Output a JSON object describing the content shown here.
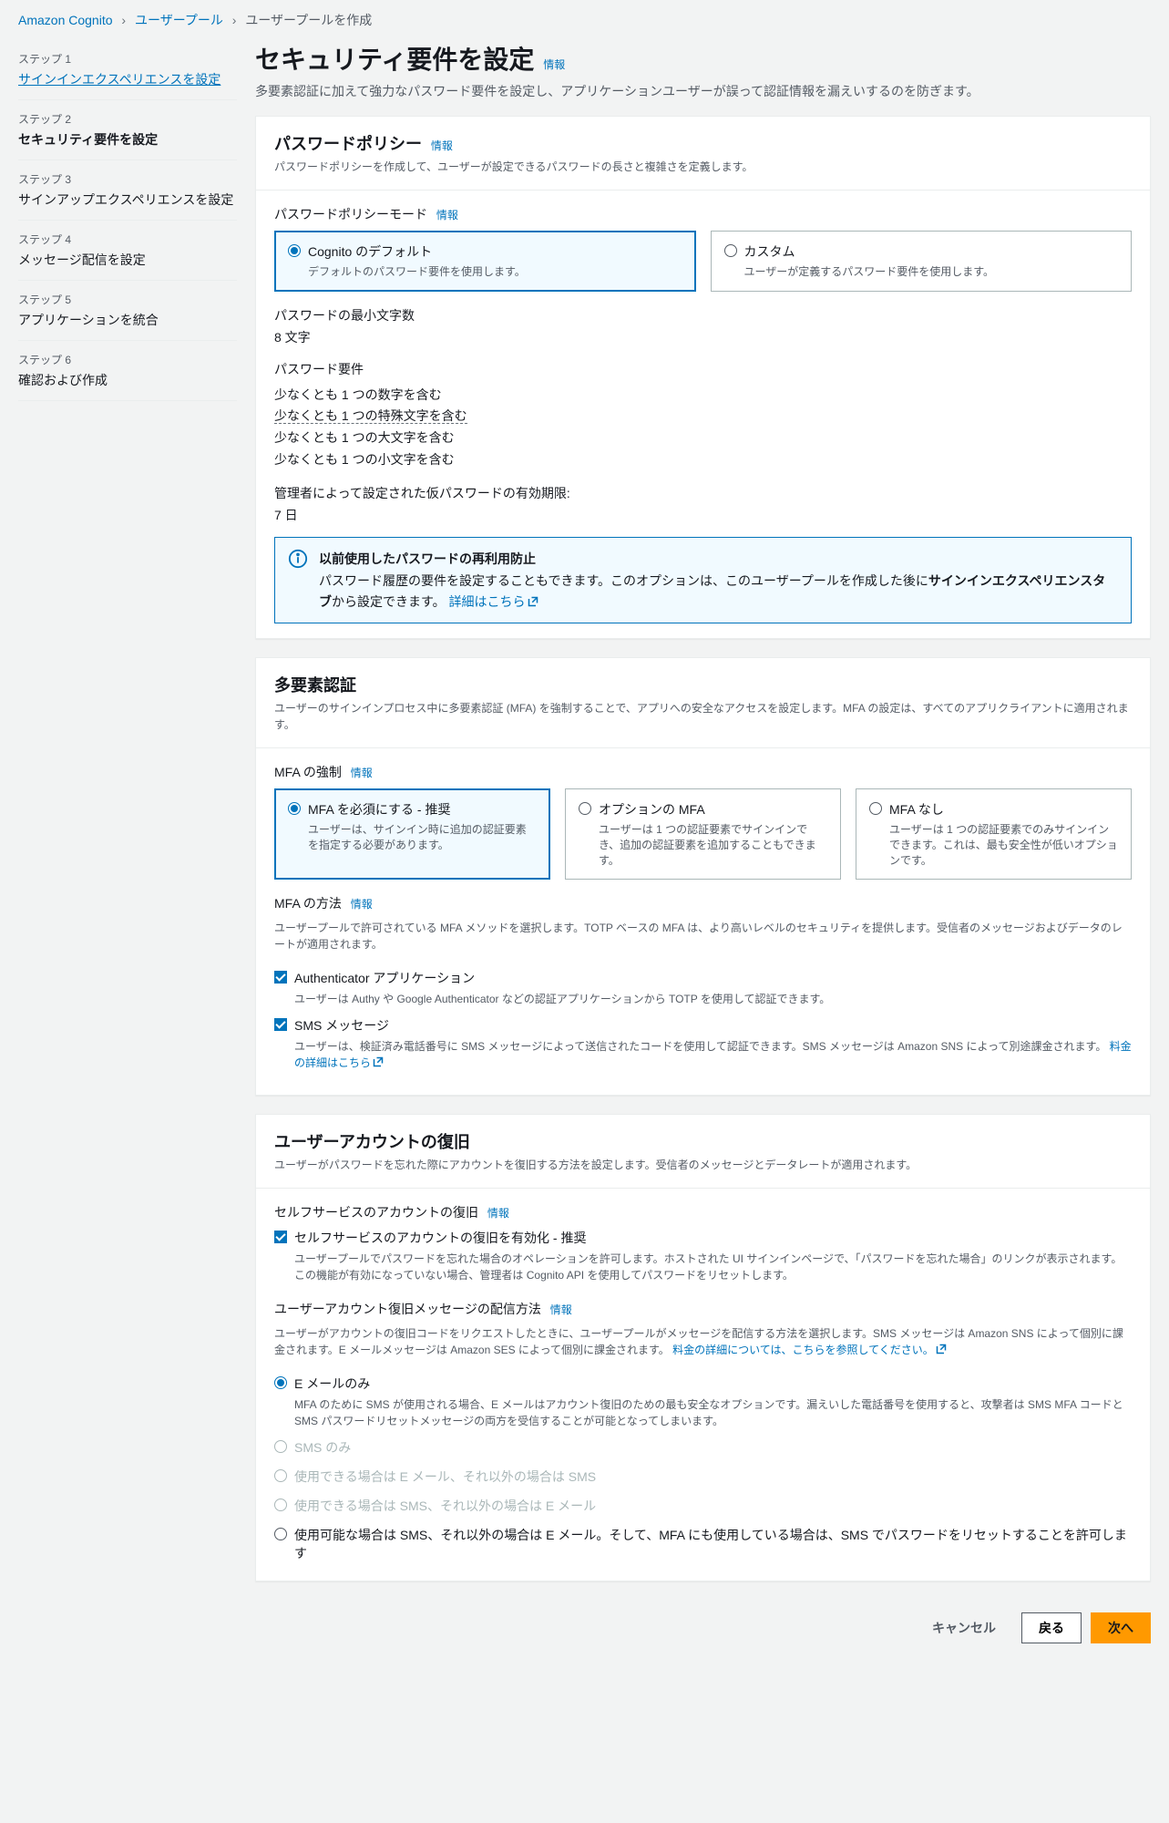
{
  "breadcrumb": {
    "items": [
      {
        "label": "Amazon Cognito",
        "link": true
      },
      {
        "label": "ユーザープール",
        "link": true
      },
      {
        "label": "ユーザープールを作成",
        "link": false
      }
    ]
  },
  "sidebar": {
    "steps": [
      {
        "label": "ステップ 1",
        "title": "サインインエクスペリエンスを設定",
        "link": true
      },
      {
        "label": "ステップ 2",
        "title": "セキュリティ要件を設定",
        "current": true
      },
      {
        "label": "ステップ 3",
        "title": "サインアップエクスペリエンスを設定"
      },
      {
        "label": "ステップ 4",
        "title": "メッセージ配信を設定"
      },
      {
        "label": "ステップ 5",
        "title": "アプリケーションを統合"
      },
      {
        "label": "ステップ 6",
        "title": "確認および作成"
      }
    ]
  },
  "page": {
    "title": "セキュリティ要件を設定",
    "info": "情報",
    "desc": "多要素認証に加えて強力なパスワード要件を設定し、アプリケーションユーザーが誤って認証情報を漏えいするのを防ぎます。"
  },
  "password": {
    "title": "パスワードポリシー",
    "info": "情報",
    "desc": "パスワードポリシーを作成して、ユーザーが設定できるパスワードの長さと複雑さを定義します。",
    "mode_label": "パスワードポリシーモード",
    "mode_info": "情報",
    "options": [
      {
        "title": "Cognito のデフォルト",
        "desc": "デフォルトのパスワード要件を使用します。",
        "selected": true
      },
      {
        "title": "カスタム",
        "desc": "ユーザーが定義するパスワード要件を使用します。",
        "selected": false
      }
    ],
    "min_label": "パスワードの最小文字数",
    "min_value": "8 文字",
    "req_label": "パスワード要件",
    "reqs": [
      {
        "text": "少なくとも 1 つの数字を含む"
      },
      {
        "text": "少なくとも 1 つの特殊文字を含む",
        "dotted": true
      },
      {
        "text": "少なくとも 1 つの大文字を含む"
      },
      {
        "text": "少なくとも 1 つの小文字を含む"
      }
    ],
    "temp_label": "管理者によって設定された仮パスワードの有効期限:",
    "temp_value": "7 日",
    "alert_title": "以前使用したパスワードの再利用防止",
    "alert_body1": "パスワード履歴の要件を設定することもできます。このオプションは、このユーザープールを作成した後に",
    "alert_bold": "サインインエクスペリエンスタブ",
    "alert_body2": "から設定できます。",
    "alert_link": "詳細はこちら"
  },
  "mfa": {
    "title": "多要素認証",
    "desc": "ユーザーのサインインプロセス中に多要素認証 (MFA) を強制することで、アプリへの安全なアクセスを設定します。MFA の設定は、すべてのアプリクライアントに適用されます。",
    "enforce_label": "MFA の強制",
    "enforce_info": "情報",
    "options": [
      {
        "title": "MFA を必須にする - 推奨",
        "desc": "ユーザーは、サインイン時に追加の認証要素を指定する必要があります。",
        "selected": true
      },
      {
        "title": "オプションの MFA",
        "desc": "ユーザーは 1 つの認証要素でサインインでき、追加の認証要素を追加することもできます。"
      },
      {
        "title": "MFA なし",
        "desc": "ユーザーは 1 つの認証要素でのみサインインできます。これは、最も安全性が低いオプションです。"
      }
    ],
    "method_label": "MFA の方法",
    "method_info": "情報",
    "method_desc": "ユーザープールで許可されている MFA メソッドを選択します。TOTP ベースの MFA は、より高いレベルのセキュリティを提供します。受信者のメッセージおよびデータのレートが適用されます。",
    "methods": [
      {
        "label": "Authenticator アプリケーション",
        "desc": "ユーザーは Authy や Google Authenticator などの認証アプリケーションから TOTP を使用して認証できます。",
        "checked": true
      },
      {
        "label": "SMS メッセージ",
        "desc_pre": "ユーザーは、検証済み電話番号に SMS メッセージによって送信されたコードを使用して認証できます。SMS メッセージは Amazon SNS によって別途課金されます。",
        "link": "料金の詳細はこちら",
        "checked": true
      }
    ]
  },
  "recovery": {
    "title": "ユーザーアカウントの復旧",
    "desc": "ユーザーがパスワードを忘れた際にアカウントを復旧する方法を設定します。受信者のメッセージとデータレートが適用されます。",
    "self_label": "セルフサービスのアカウントの復旧",
    "self_info": "情報",
    "self_check_label": "セルフサービスのアカウントの復旧を有効化 - 推奨",
    "self_check_desc": "ユーザープールでパスワードを忘れた場合のオペレーションを許可します。ホストされた UI サインインページで、「パスワードを忘れた場合」のリンクが表示されます。この機能が有効になっていない場合、管理者は Cognito API を使用してパスワードをリセットします。",
    "delivery_label": "ユーザーアカウント復旧メッセージの配信方法",
    "delivery_info": "情報",
    "delivery_desc_pre": "ユーザーがアカウントの復旧コードをリクエストしたときに、ユーザープールがメッセージを配信する方法を選択します。SMS メッセージは Amazon SNS によって個別に課金されます。E メールメッセージは Amazon SES によって個別に課金されます。",
    "delivery_link": "料金の詳細については、こちらを参照してください。",
    "options": [
      {
        "label": "E メールのみ",
        "desc": "MFA のために SMS が使用される場合、E メールはアカウント復旧のための最も安全なオプションです。漏えいした電話番号を使用すると、攻撃者は SMS MFA コードと SMS パスワードリセットメッセージの両方を受信することが可能となってしまいます。",
        "checked": true
      },
      {
        "label": "SMS のみ",
        "disabled": true
      },
      {
        "label": "使用できる場合は E メール、それ以外の場合は SMS",
        "disabled": true
      },
      {
        "label": "使用できる場合は SMS、それ以外の場合は E メール",
        "disabled": true
      },
      {
        "label": "使用可能な場合は SMS、それ以外の場合は E メール。そして、MFA にも使用している場合は、SMS でパスワードをリセットすることを許可します"
      }
    ]
  },
  "footer": {
    "cancel": "キャンセル",
    "back": "戻る",
    "next": "次へ"
  }
}
